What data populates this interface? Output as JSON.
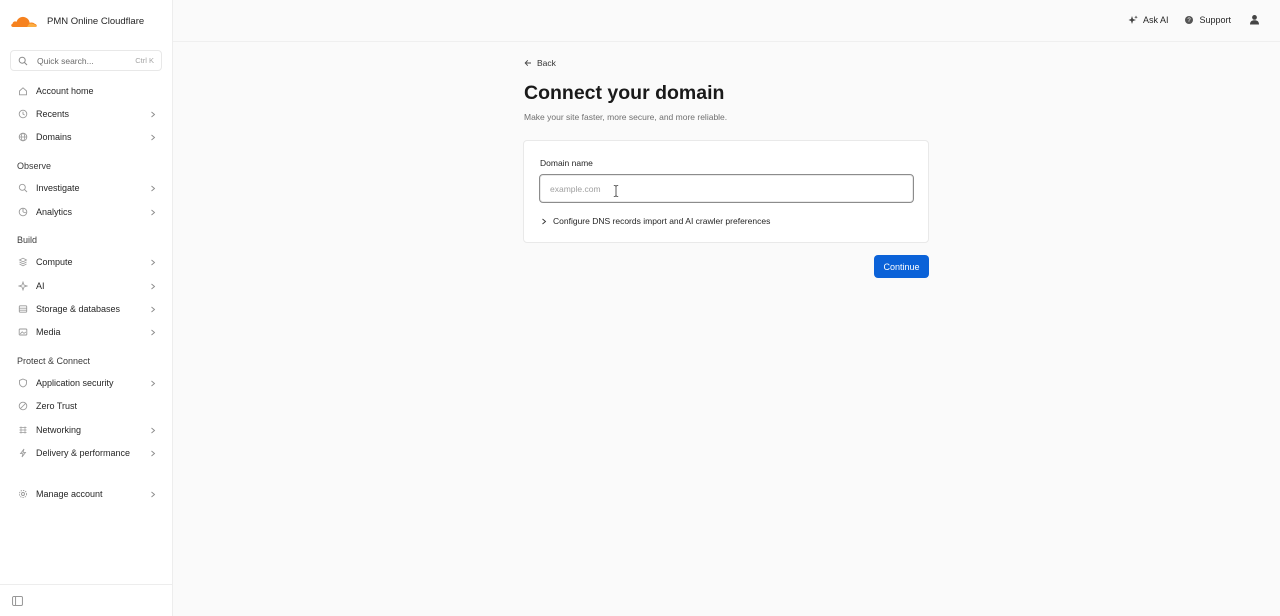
{
  "account": {
    "name": "PMN Online Cloudflare",
    "logo_icon": "cloudflare-cloud-icon",
    "logo_color": "#f6821f"
  },
  "search": {
    "placeholder": "Quick search...",
    "shortcut": "Ctrl K",
    "icon": "search-icon"
  },
  "sidebar": {
    "items": [
      {
        "label": "Account home",
        "icon": "home-icon",
        "chevron": false
      },
      {
        "label": "Recents",
        "icon": "clock-icon",
        "chevron": true
      },
      {
        "label": "Domains",
        "icon": "globe-icon",
        "chevron": true
      },
      {
        "label": "Investigate",
        "icon": "magnifier-icon",
        "chevron": true
      },
      {
        "label": "Analytics",
        "icon": "chart-icon",
        "chevron": true
      },
      {
        "label": "Compute",
        "icon": "compute-icon",
        "chevron": true
      },
      {
        "label": "AI",
        "icon": "sparkle-icon",
        "chevron": true
      },
      {
        "label": "Storage & databases",
        "icon": "database-icon",
        "chevron": true
      },
      {
        "label": "Media",
        "icon": "media-icon",
        "chevron": true
      },
      {
        "label": "Application security",
        "icon": "shield-icon",
        "chevron": true
      },
      {
        "label": "Zero Trust",
        "icon": "zero-trust-icon",
        "chevron": false
      },
      {
        "label": "Networking",
        "icon": "network-icon",
        "chevron": true
      },
      {
        "label": "Delivery & performance",
        "icon": "bolt-icon",
        "chevron": true
      },
      {
        "label": "Manage account",
        "icon": "gear-icon",
        "chevron": true
      }
    ],
    "sections": [
      "Observe",
      "Build",
      "Protect & Connect"
    ]
  },
  "topbar": {
    "ask_ai": "Ask AI",
    "support": "Support",
    "user_icon": "user-icon"
  },
  "main": {
    "back_label": "Back",
    "title": "Connect your domain",
    "subtitle": "Make your site faster, more secure, and more reliable.",
    "domain_label": "Domain name",
    "domain_placeholder": "example.com",
    "domain_value": "",
    "config_label": "Configure DNS records import and AI crawler preferences",
    "continue_label": "Continue"
  },
  "colors": {
    "primary_button": "#0b62d8"
  }
}
